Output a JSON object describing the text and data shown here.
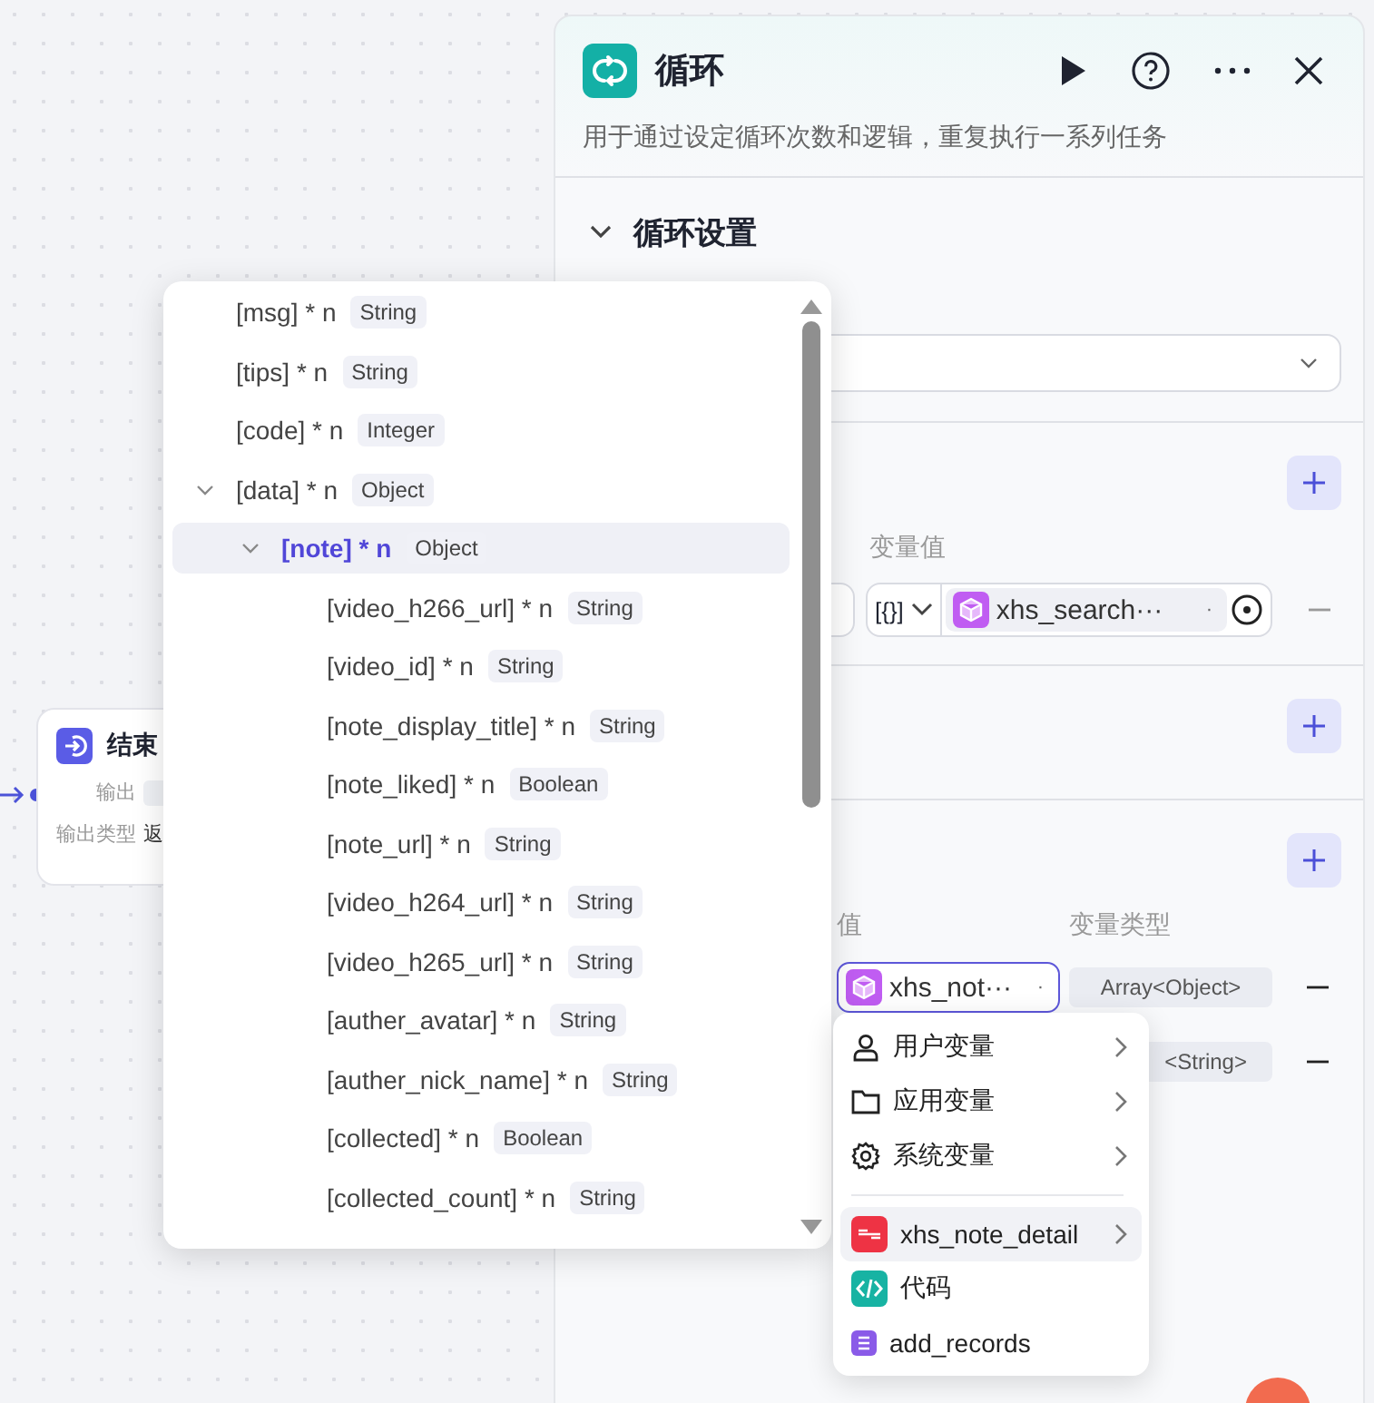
{
  "end_node": {
    "title": "结束",
    "rows": [
      {
        "label": "输出"
      },
      {
        "label": "输出类型",
        "value": "返"
      }
    ]
  },
  "panel": {
    "title": "循环",
    "description": "用于通过设定循环次数和逻辑，重复执行一系列任务",
    "section": {
      "title": "循环设置",
      "expanded": true
    },
    "loop_block": {
      "columns": [
        "变量值"
      ],
      "rows": [
        {
          "type_selector": "[{}]",
          "value": "xhs_search···",
          "separator": "·"
        }
      ]
    },
    "output_block": {
      "columns": [
        "值",
        "变量类型"
      ],
      "rows": [
        {
          "value": "xhs_not···",
          "separator": "·",
          "type": "Array<Object>",
          "focused": true
        },
        {
          "type": "<String>",
          "focused": false
        }
      ]
    }
  },
  "tree_popup": {
    "items": [
      {
        "name": "[msg] * n",
        "type": "String",
        "selected": false
      },
      {
        "name": "[tips] * n",
        "type": "String",
        "selected": false
      },
      {
        "name": "[code] * n",
        "type": "Integer",
        "selected": false
      },
      {
        "name": "[data] * n",
        "type": "Object",
        "selected": false,
        "expanded": true,
        "children": [
          {
            "name": "[note] * n",
            "type": "Object",
            "selected": true,
            "expanded": true,
            "children": [
              {
                "name": "[video_h266_url] * n",
                "type": "String",
                "selected": false
              },
              {
                "name": "[video_id] * n",
                "type": "String",
                "selected": false
              },
              {
                "name": "[note_display_title] * n",
                "type": "String",
                "selected": false
              },
              {
                "name": "[note_liked] * n",
                "type": "Boolean",
                "selected": false
              },
              {
                "name": "[note_url] * n",
                "type": "String",
                "selected": false
              },
              {
                "name": "[video_h264_url] * n",
                "type": "String",
                "selected": false
              },
              {
                "name": "[video_h265_url] * n",
                "type": "String",
                "selected": false
              },
              {
                "name": "[auther_avatar] * n",
                "type": "String",
                "selected": false
              },
              {
                "name": "[auther_nick_name] * n",
                "type": "String",
                "selected": false
              },
              {
                "name": "[collected] * n",
                "type": "Boolean",
                "selected": false
              },
              {
                "name": "[collected_count] * n",
                "type": "String",
                "selected": false
              }
            ]
          }
        ]
      }
    ]
  },
  "menu": {
    "items": [
      {
        "kind": "category",
        "label": "用户变量",
        "has_submenu": true,
        "selected": false
      },
      {
        "kind": "category",
        "label": "应用变量",
        "has_submenu": true,
        "selected": false
      },
      {
        "kind": "category",
        "label": "系统变量",
        "has_submenu": true,
        "selected": false
      },
      {
        "kind": "node",
        "label": "xhs_note_detail",
        "has_submenu": true,
        "selected": true,
        "color": "#ee3344"
      },
      {
        "kind": "node",
        "label": "代码",
        "has_submenu": false,
        "selected": false,
        "color": "#17b3a3"
      },
      {
        "kind": "node",
        "label": "add_records",
        "has_submenu": false,
        "selected": false,
        "color": "#8a5be8"
      }
    ]
  }
}
